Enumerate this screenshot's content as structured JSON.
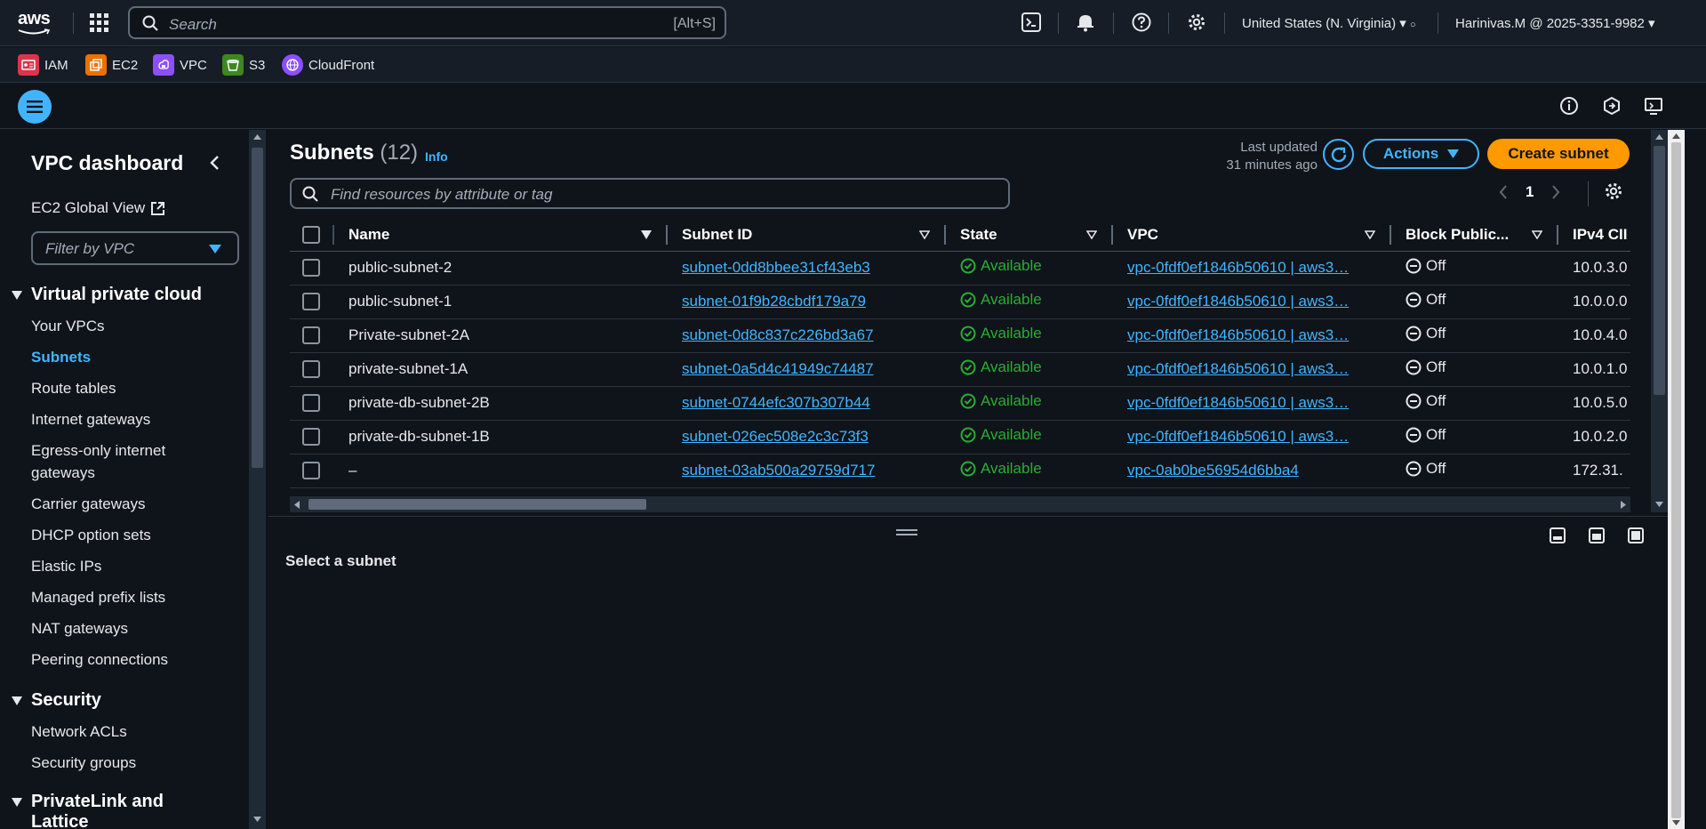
{
  "topbar": {
    "logo_text": "aws",
    "search_placeholder": "Search",
    "search_shortcut": "[Alt+S]",
    "region": "United States (N. Virginia) ▾",
    "account": "Harinivas.M @ 2025-3351-9982 ▾"
  },
  "favorites": [
    {
      "label": "IAM",
      "color": "#dd344c"
    },
    {
      "label": "EC2",
      "color": "#ed7100"
    },
    {
      "label": "VPC",
      "color": "#8c4fff"
    },
    {
      "label": "S3",
      "color": "#3f8624"
    },
    {
      "label": "CloudFront",
      "color": "#8c4fff"
    }
  ],
  "sidebar": {
    "title": "VPC dashboard",
    "global_view": "EC2 Global View",
    "filter_placeholder": "Filter by VPC",
    "section_vpc": "Virtual private cloud",
    "vpc_items": [
      "Your VPCs",
      "Subnets",
      "Route tables",
      "Internet gateways",
      "Egress-only internet gateways",
      "Carrier gateways",
      "DHCP option sets",
      "Elastic IPs",
      "Managed prefix lists",
      "NAT gateways",
      "Peering connections"
    ],
    "section_security": "Security",
    "security_items": [
      "Network ACLs",
      "Security groups"
    ],
    "section_privatelink": "PrivateLink and Lattice"
  },
  "main": {
    "title": "Subnets",
    "count": "(12)",
    "info": "Info",
    "last_updated_label": "Last updated",
    "last_updated_value": "31 minutes ago",
    "actions_label": "Actions",
    "create_label": "Create subnet",
    "find_placeholder": "Find resources by attribute or tag",
    "page": "1",
    "columns": [
      "Name",
      "Subnet ID",
      "State",
      "VPC",
      "Block Public...",
      "IPv4 CII"
    ],
    "rows": [
      {
        "name": "public-subnet-2",
        "id": "subnet-0dd8bbee31cf43eb3",
        "state": "Available",
        "vpc": "vpc-0fdf0ef1846b50610 | aws3…",
        "block": "Off",
        "ipv4": "10.0.3.0"
      },
      {
        "name": "public-subnet-1",
        "id": "subnet-01f9b28cbdf179a79",
        "state": "Available",
        "vpc": "vpc-0fdf0ef1846b50610 | aws3…",
        "block": "Off",
        "ipv4": "10.0.0.0"
      },
      {
        "name": "Private-subnet-2A",
        "id": "subnet-0d8c837c226bd3a67",
        "state": "Available",
        "vpc": "vpc-0fdf0ef1846b50610 | aws3…",
        "block": "Off",
        "ipv4": "10.0.4.0"
      },
      {
        "name": "private-subnet-1A",
        "id": "subnet-0a5d4c41949c74487",
        "state": "Available",
        "vpc": "vpc-0fdf0ef1846b50610 | aws3…",
        "block": "Off",
        "ipv4": "10.0.1.0"
      },
      {
        "name": "private-db-subnet-2B",
        "id": "subnet-0744efc307b307b44",
        "state": "Available",
        "vpc": "vpc-0fdf0ef1846b50610 | aws3…",
        "block": "Off",
        "ipv4": "10.0.5.0"
      },
      {
        "name": "private-db-subnet-1B",
        "id": "subnet-026ec508e2c3c73f3",
        "state": "Available",
        "vpc": "vpc-0fdf0ef1846b50610 | aws3…",
        "block": "Off",
        "ipv4": "10.0.2.0"
      },
      {
        "name": "–",
        "id": "subnet-03ab500a29759d717",
        "state": "Available",
        "vpc": "vpc-0ab0be56954d6bba4",
        "block": "Off",
        "ipv4": "172.31."
      }
    ]
  },
  "split": {
    "select_text": "Select a subnet"
  },
  "colors": {
    "accent": "#42b4ff",
    "primary_button": "#ff9900",
    "success": "#29ad32",
    "background": "#0f141a"
  }
}
